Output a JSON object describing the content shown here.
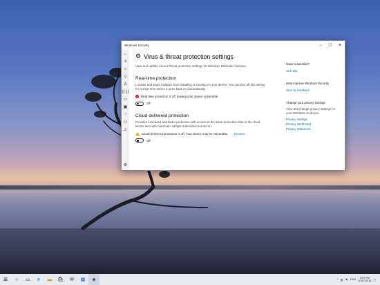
{
  "window": {
    "title": "Windows Security"
  },
  "page": {
    "heading": "Virus & threat protection settings",
    "description": "View and update Virus & threat protection settings for Windows Defender Antivirus."
  },
  "realtime": {
    "title": "Real-time protection",
    "description": "Locates and stops malware from installing or running on your device. You can turn off this setting for a short time before it turns back on automatically.",
    "warning": "Real-time protection is off, leaving your device vulnerable.",
    "toggle_label": "Off"
  },
  "cloud": {
    "title": "Cloud-delivered protection",
    "description": "Provides increased and faster protection with access to the latest protection data in the cloud. Works best with Automatic sample submission turned on.",
    "warning": "Cloud-delivered protection is off. Your device may be vulnerable.",
    "dismiss": "Dismiss",
    "toggle_label": "Off"
  },
  "side": {
    "question_title": "Have a question?",
    "get_help": "Get help",
    "improve_title": "Help improve Windows Security",
    "feedback": "Give us feedback",
    "privacy_title": "Change your privacy settings",
    "privacy_text": "View and change privacy settings for your Windows 10 device.",
    "privacy_settings": "Privacy settings",
    "privacy_dashboard": "Privacy dashboard",
    "privacy_statement": "Privacy Statement"
  },
  "taskbar": {
    "lang": "ENG",
    "time": "2:07 PM",
    "date": "10/17/2018"
  }
}
